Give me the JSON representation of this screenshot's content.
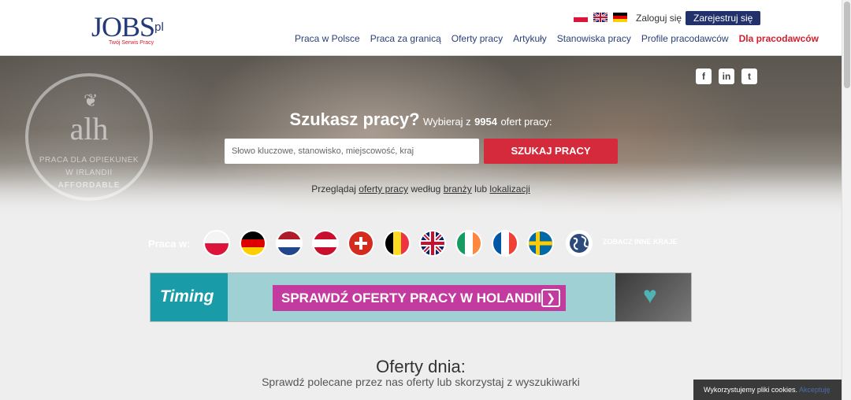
{
  "header": {
    "logo": {
      "main": "JOBS",
      "tld": ".pl",
      "tagline": "Twój Serwis Pracy"
    },
    "login_label": "Zaloguj się",
    "register_label": "Zarejestruj się",
    "nav": [
      "Praca w Polsce",
      "Praca za granicą",
      "Oferty pracy",
      "Artykuły",
      "Stanowiska pracy",
      "Profile pracodawców"
    ],
    "nav_cta": "Dla pracodawców",
    "lang_icons": [
      "flag-pl-icon",
      "flag-gb-icon",
      "flag-de-icon"
    ]
  },
  "hero": {
    "badge": {
      "brand": "alh",
      "line1": "PRACA DLA OPIEKUNEK",
      "line2": "W IRLANDII",
      "line3": "AFFORDABLE"
    },
    "question": "Szukasz pracy?",
    "prefix": "Wybieraj z",
    "count": "9954",
    "suffix": "ofert pracy:",
    "search_placeholder": "Słowo kluczowe, stanowisko, miejscowość, kraj",
    "search_button": "SZUKAJ PRACY",
    "browse": {
      "t1": "Przeglądaj",
      "l1": "oferty pracy",
      "t2": "według",
      "l2": "branży",
      "t3": "lub",
      "l3": "lokalizacji"
    },
    "social_icons": [
      "facebook-icon",
      "linkedin-icon",
      "twitter-icon"
    ]
  },
  "countries": {
    "label": "Praca w:",
    "more": "ZOBACZ INNE KRAJE",
    "flags": [
      "poland",
      "germany",
      "netherlands",
      "austria",
      "switzerland",
      "belgium",
      "united-kingdom",
      "ireland",
      "france",
      "sweden",
      "globe"
    ]
  },
  "banner": {
    "brand": "Timing",
    "cta": "SPRAWDŹ OFERTY PRACY W HOLANDII"
  },
  "offers": {
    "title": "Oferty dnia:",
    "subtitle": "Sprawdź polecane przez nas oferty lub skorzystaj z wyszukiwarki"
  },
  "cookie": {
    "text": "Wykorzystujemy pliki cookies.",
    "accept": "Akceptuję"
  },
  "colors": {
    "navy": "#22316b",
    "accent_red": "#d52a3c",
    "banner_pink": "#c33b9e",
    "banner_teal": "#1a9ca8"
  }
}
